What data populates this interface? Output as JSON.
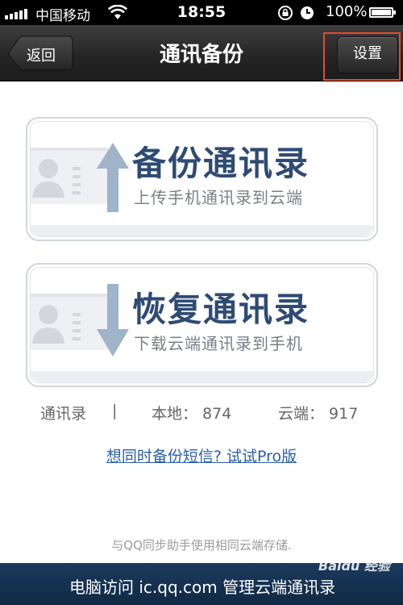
{
  "status_bar": {
    "carrier": "中国移动",
    "time": "18:55",
    "battery": "100%",
    "icons": [
      "signal-icon",
      "wifi-icon",
      "rotation-lock-icon",
      "alarm-icon",
      "battery-icon"
    ]
  },
  "nav": {
    "back_label": "返回",
    "title": "通讯备份",
    "settings_label": "设置",
    "highlight_color": "#e64a2e"
  },
  "backup_card": {
    "title": "备份通讯录",
    "subtitle": "上传手机通讯录到云端",
    "icon": "contact-upload-icon"
  },
  "restore_card": {
    "title": "恢复通讯录",
    "subtitle": "下载云端通讯录到手机",
    "icon": "contact-download-icon"
  },
  "stats": {
    "label": "通讯录",
    "separator": "|",
    "local": "本地：  874",
    "cloud": "云端：  917"
  },
  "pro_link": "想同时备份短信?  试试Pro版",
  "footer_note": "与QQ同步助手使用相同云端存储.",
  "bottom_banner": "电脑访问 ic.qq.com 管理云端通讯录",
  "watermark": "Baidu 经验",
  "colors": {
    "card_title": "#2e4b73",
    "link": "#2a5fa5",
    "banner": "#163352"
  }
}
